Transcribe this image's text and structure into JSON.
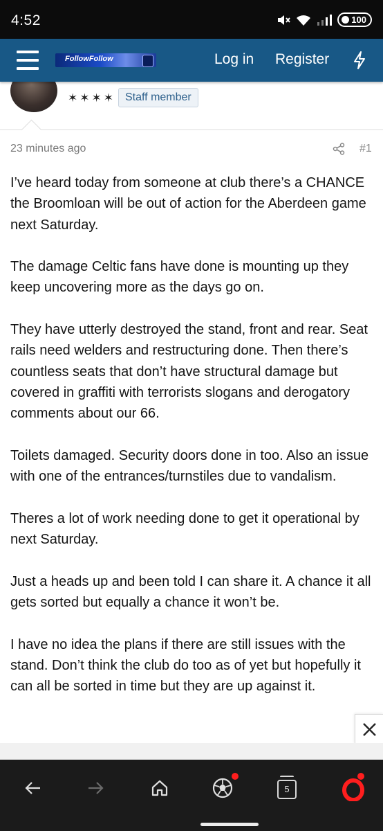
{
  "status_bar": {
    "time": "4:52",
    "battery": "100"
  },
  "header": {
    "site_logo": "FollowFollow",
    "login_label": "Log in",
    "register_label": "Register",
    "icons": {
      "menu": "hamburger-menu-icon",
      "whats_new": "lightning-bolt-icon"
    }
  },
  "post": {
    "rank_stars": "✶✶✶✶",
    "role_badge": "Staff member",
    "time_ago": "23 minutes ago",
    "post_number": "#1",
    "paragraphs": [
      "I’ve heard today from someone at club there’s a CHANCE the Broomloan will be out of action for the Aberdeen game next Saturday.",
      "The damage Celtic fans have done is mounting up they keep uncovering more as the days go on.",
      "They have utterly destroyed the stand, front and rear. Seat rails need welders and restructuring done. Then there’s countless seats that don’t have structural damage but covered in graffiti with terrorists slogans and derogatory comments about our 66.",
      "Toilets damaged. Security doors done in too. Also an issue with one of the entrances/turnstiles due to vandalism.",
      "Theres a lot of work needing done to get it operational by next Saturday.",
      "Just a heads up and been told I can share it. A chance it all gets sorted but equally a chance it won’t be.",
      "I have no idea the plans if there are still issues with the stand. Don’t think the club do too as of yet but hopefully it can all be sorted in time but they are up against it."
    ]
  },
  "browser_bar": {
    "tabs_count": "5",
    "icons": [
      "back-arrow-icon",
      "forward-arrow-icon",
      "home-icon",
      "football-icon",
      "tabs-icon",
      "opera-icon"
    ]
  },
  "colors": {
    "header_bg": "#185886",
    "badge_text": "#2c5f8b",
    "browser_bg": "#1b1b1b",
    "accent_red": "#ff1e1e"
  }
}
